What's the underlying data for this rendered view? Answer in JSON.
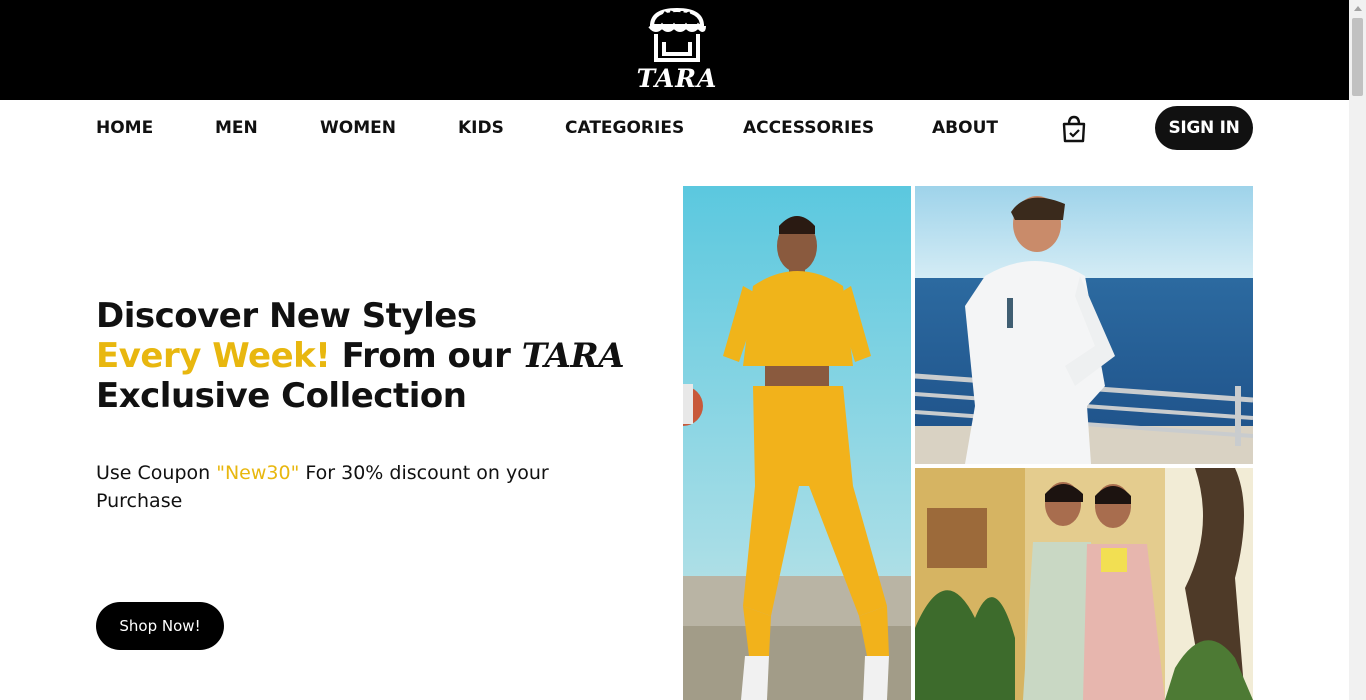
{
  "brand": {
    "logo_text": "TARA",
    "icon": "storefront-icon"
  },
  "nav": {
    "items": [
      {
        "label": "HOME"
      },
      {
        "label": "MEN"
      },
      {
        "label": "WOMEN"
      },
      {
        "label": "KIDS"
      },
      {
        "label": "CATEGORIES"
      },
      {
        "label": "ACCESSORIES"
      },
      {
        "label": "ABOUT"
      }
    ],
    "cart_icon": "shopping-bag-icon",
    "signin_label": "SIGN IN"
  },
  "hero": {
    "line1": "Discover New Styles",
    "accent": "Every Week!",
    "line2_rest": " From our ",
    "brand": "TARA",
    "line3": "Exclusive Collection",
    "coupon_prefix": "Use Coupon ",
    "coupon_code": "\"New30\"",
    "coupon_suffix": " For 30% discount on your Purchase",
    "cta": "Shop Now!"
  },
  "colors": {
    "accent": "#e8b70f",
    "header_bg": "#000000",
    "button_bg": "#111111"
  },
  "gallery": [
    {
      "name": "woman-yellow-tracksuit-photo"
    },
    {
      "name": "man-white-shirt-sea-photo"
    },
    {
      "name": "women-sarees-photo"
    }
  ]
}
